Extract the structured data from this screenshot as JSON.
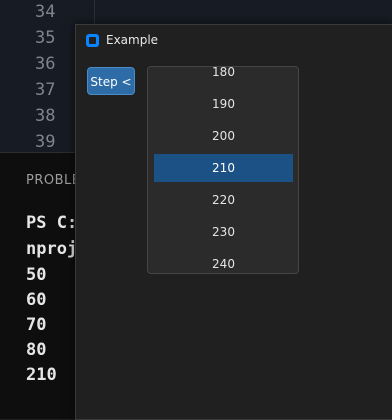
{
  "editor": {
    "line_numbers": [
      "34",
      "35",
      "36",
      "37",
      "38",
      "39"
    ]
  },
  "terminal": {
    "panel_tab": "PROBLE",
    "lines": [
      "PS C:",
      "nproj",
      "50",
      "60",
      "70",
      "80",
      "210"
    ]
  },
  "window": {
    "title": "Example",
    "step_button_label": "Step <",
    "list": {
      "items": [
        "180",
        "190",
        "200",
        "210",
        "220",
        "230",
        "240"
      ],
      "selected": "210"
    }
  },
  "colors": {
    "accent": "#0a84ff",
    "selection": "#1b5184",
    "button": "#2d6ca7"
  }
}
